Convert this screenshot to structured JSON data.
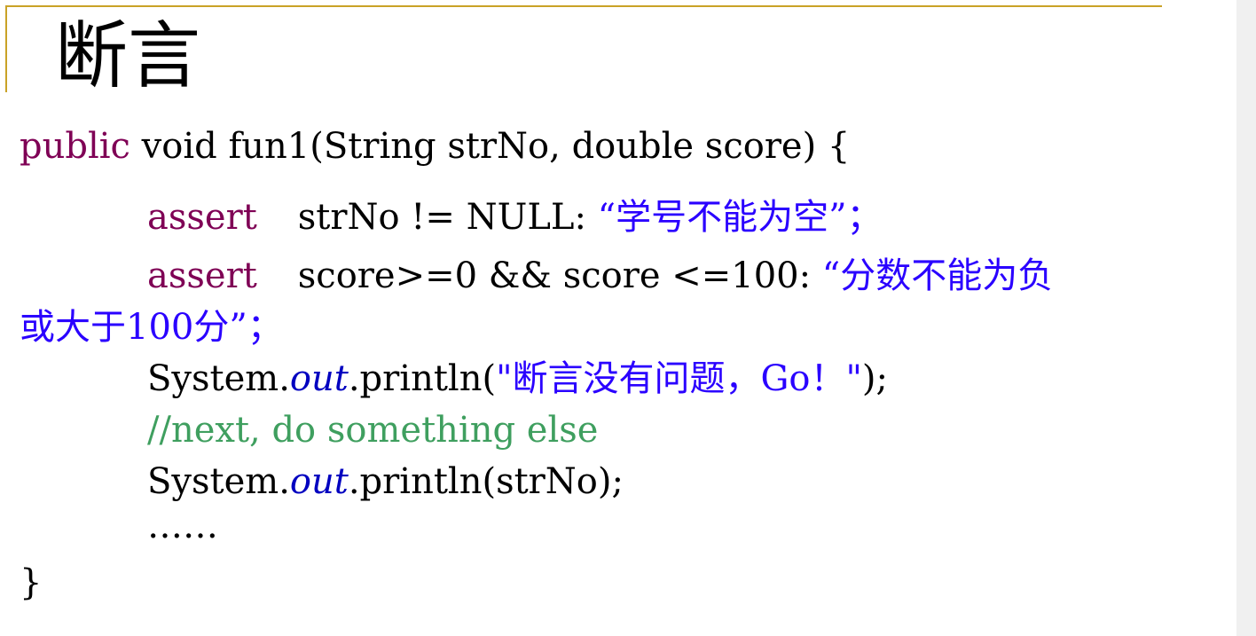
{
  "title": "断言",
  "code": {
    "line0": {
      "kw": "public",
      "rest": " void fun1(String strNo, double score) {"
    },
    "line1": {
      "kw": "assert",
      "rest": "strNo != NULL: ",
      "msg": "“学号不能为空”；"
    },
    "line2": {
      "kw": "assert",
      "rest": "score>=0 && score <=100: ",
      "msg": "“分数不能为负"
    },
    "line3": {
      "msg": "或大于100分”；"
    },
    "line4": {
      "pre": "System.",
      "field": "out",
      "mid": ".println(",
      "str": "\"断言没有问题，Go！\"",
      "post": ");"
    },
    "line5": {
      "comment": "//next, do something else"
    },
    "line6": {
      "pre": "System.",
      "field": "out",
      "rest": ".println(strNo);"
    },
    "line7": {
      "text": "……"
    },
    "line8": {
      "text": "}"
    }
  },
  "colors": {
    "keyword": "#7f0055",
    "string": "#2a00ff",
    "comment": "#3f9f5f",
    "field": "#0000c0",
    "rule": "#c9a227"
  }
}
